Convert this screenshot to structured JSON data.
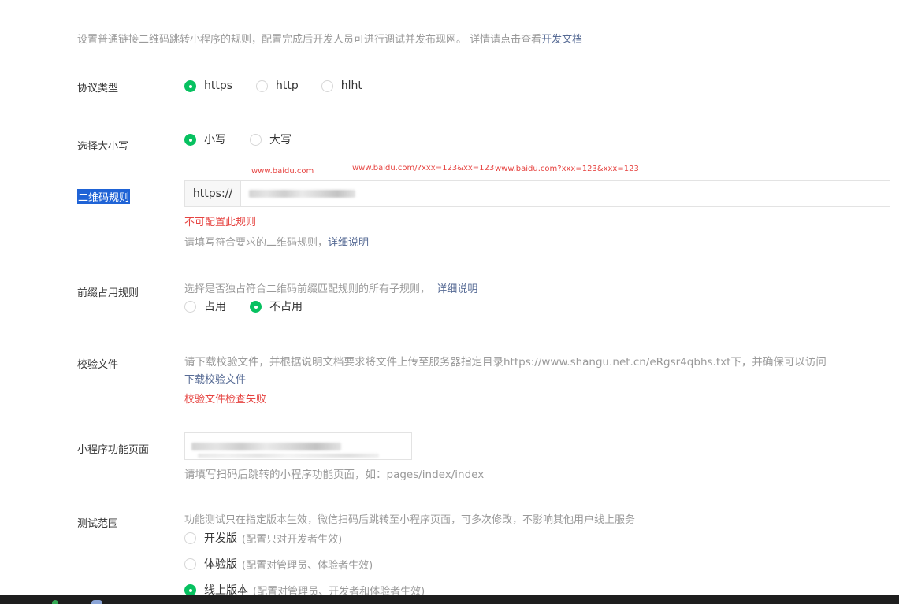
{
  "intro": {
    "text": "设置普通链接二维码跳转小程序的规则，配置完成后开发人员可进行调试并发布现网。 详情请点击查看",
    "link": "开发文档"
  },
  "protocol": {
    "label": "协议类型",
    "options": [
      "https",
      "http",
      "hlht"
    ],
    "selected": "https"
  },
  "case": {
    "label": "选择大小写",
    "options": [
      "小写",
      "大写"
    ],
    "selected": "小写"
  },
  "annotations": [
    "www.baidu.com",
    "www.baidu.com/?xxx=123&xx=123",
    "www.baidu.com?xxx=123&xxx=123"
  ],
  "qr_rule": {
    "label": "二维码规则",
    "prefix": "https://",
    "error": "不可配置此规则",
    "hint": "请填写符合要求的二维码规则，",
    "hint_link": "详细说明"
  },
  "prefix_rule": {
    "label": "前缀占用规则",
    "desc": "选择是否独占符合二维码前缀匹配规则的所有子规则，",
    "desc_link": "详细说明",
    "options": [
      "占用",
      "不占用"
    ],
    "selected": "不占用"
  },
  "verify_file": {
    "label": "校验文件",
    "desc": "请下载校验文件，并根据说明文档要求将文件上传至服务器指定目录https://www.shangu.net.cn/eRgsr4qbhs.txt下，并确保可以访问",
    "download_link": "下载校验文件",
    "error": "校验文件检查失败"
  },
  "page": {
    "label": "小程序功能页面",
    "hint": "请填写扫码后跳转的小程序功能页面，如：pages/index/index"
  },
  "test_scope": {
    "label": "测试范围",
    "desc": "功能测试只在指定版本生效，微信扫码后跳转至小程序页面，可多次修改，不影响其他用户线上服务",
    "options": [
      {
        "label": "开发版",
        "note": "(配置只对开发者生效)"
      },
      {
        "label": "体验版",
        "note": "(配置对管理员、体验者生效)"
      },
      {
        "label": "线上版本",
        "note": "(配置对管理员、开发者和体验者生效)"
      }
    ],
    "selected": "线上版本"
  },
  "colors": {
    "accent": "#07c160",
    "link": "#576b95",
    "error": "#e64340",
    "hint": "#9a9a9a",
    "label_highlight": "#1f63d6"
  }
}
